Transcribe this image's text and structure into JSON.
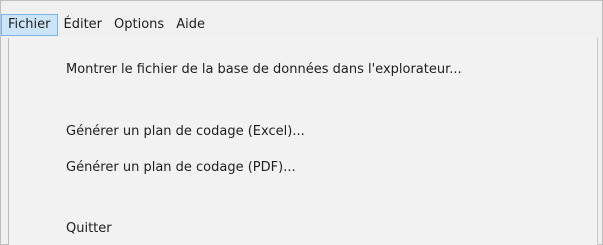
{
  "menubar": {
    "items": [
      {
        "label": "Fichier"
      },
      {
        "label": "Éditer"
      },
      {
        "label": "Options"
      },
      {
        "label": "Aide"
      }
    ]
  },
  "dropdown": {
    "items": [
      {
        "label": "Montrer le fichier de la base de données dans l'explorateur..."
      },
      {
        "label": "Générer un plan de codage (Excel)..."
      },
      {
        "label": "Générer un plan de codage (PDF)..."
      },
      {
        "label": "Quitter"
      }
    ]
  },
  "colors": {
    "menu_highlight_bg": "#cce4f7",
    "menu_highlight_border": "#7eb4ea",
    "background": "#f0f0f0"
  }
}
